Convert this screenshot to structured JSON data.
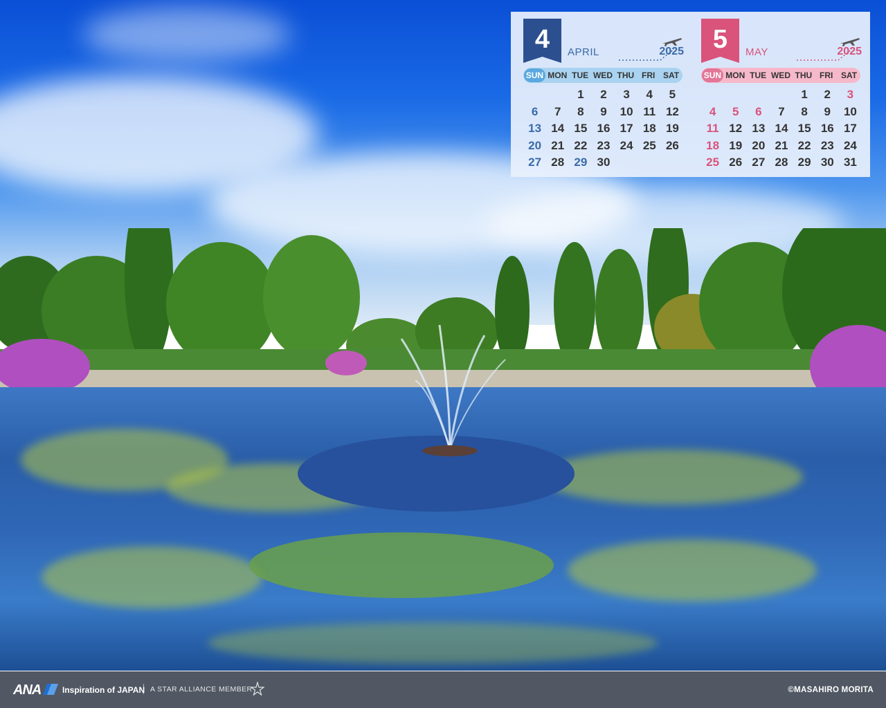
{
  "calendar": {
    "weekday_labels": [
      "SUN",
      "MON",
      "TUE",
      "WED",
      "THU",
      "FRI",
      "SAT"
    ],
    "april": {
      "number": "4",
      "name": "APRIL",
      "year": "2025",
      "days": [
        "",
        "",
        "1",
        "2",
        "3",
        "4",
        "5",
        "6",
        "7",
        "8",
        "9",
        "10",
        "11",
        "12",
        "13",
        "14",
        "15",
        "16",
        "17",
        "18",
        "19",
        "20",
        "21",
        "22",
        "23",
        "24",
        "25",
        "26",
        "27",
        "28",
        "29",
        "30",
        "",
        "",
        ""
      ],
      "holidays": [
        "29"
      ]
    },
    "may": {
      "number": "5",
      "name": "MAY",
      "year": "2025",
      "days": [
        "",
        "",
        "",
        "",
        "1",
        "2",
        "3",
        "4",
        "5",
        "6",
        "7",
        "8",
        "9",
        "10",
        "11",
        "12",
        "13",
        "14",
        "15",
        "16",
        "17",
        "18",
        "19",
        "20",
        "21",
        "22",
        "23",
        "24",
        "25",
        "26",
        "27",
        "28",
        "29",
        "30",
        "31"
      ],
      "holidays": [
        "3",
        "4",
        "5",
        "6"
      ]
    },
    "colors": {
      "april_accent": "#2c4f8f",
      "may_accent": "#d9537a"
    }
  },
  "footer": {
    "logo": "ANA",
    "tagline": "Inspiration of JAPAN",
    "alliance": "A STAR ALLIANCE MEMBER",
    "credit": "©MASAHIRO MORITA"
  },
  "icons": [
    "airplane-icon",
    "star-alliance-icon",
    "ana-logo-icon"
  ]
}
